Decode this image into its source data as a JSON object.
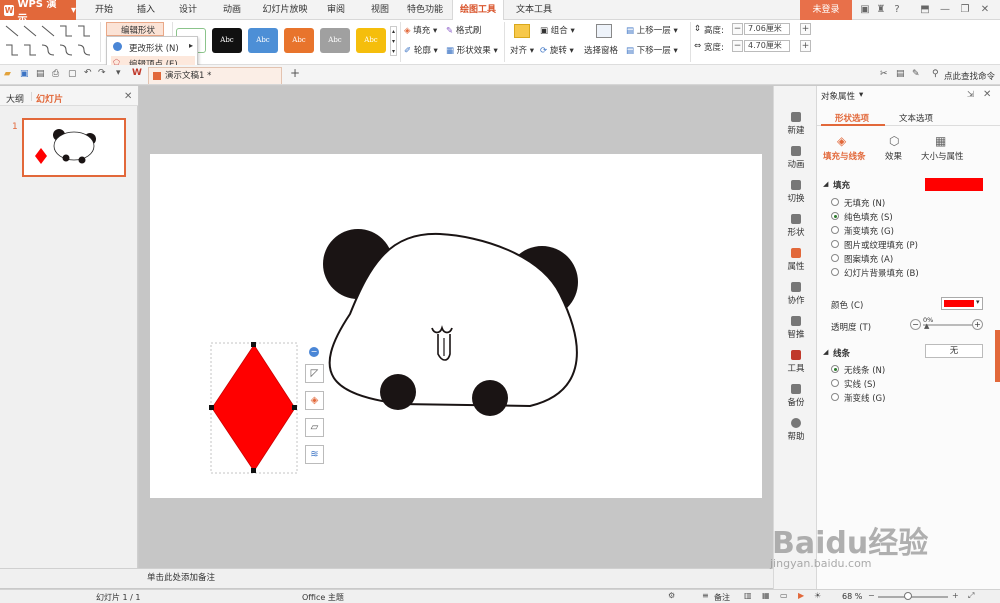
{
  "app": {
    "name": "WPS 演示"
  },
  "menu": {
    "tabs": [
      "开始",
      "插入",
      "设计",
      "动画",
      "幻灯片放映",
      "审阅",
      "视图",
      "特色功能",
      "绘图工具",
      "文本工具"
    ],
    "active": "绘图工具",
    "login": "未登录"
  },
  "ribbon": {
    "edit_shape": "编辑形状",
    "style_label": "Abc",
    "fill": "填充",
    "format_painter": "格式刷",
    "outline": "轮廓",
    "shape_effects": "形状效果",
    "align": "对齐",
    "group": "组合",
    "rotate": "旋转",
    "selection_pane": "选择窗格",
    "bring_forward": "上移一层",
    "send_backward": "下移一层",
    "height_label": "高度:",
    "height_value": "7.06厘米",
    "width_label": "宽度:",
    "width_value": "4.70厘米"
  },
  "dropdown": {
    "items": [
      "更改形状 (N)",
      "编辑顶点 (E)"
    ]
  },
  "quickbar": {
    "doc_tab": "演示文稿1 *",
    "search": "点此查找命令"
  },
  "leftpanel": {
    "tab_outline": "大纲",
    "tab_slides": "幻灯片",
    "slide_number": "1"
  },
  "sidebar": {
    "items": [
      "新建",
      "动画",
      "切换",
      "形状",
      "属性",
      "协作",
      "智推",
      "工具",
      "备份",
      "帮助"
    ]
  },
  "props": {
    "title": "对象属性",
    "tab_shape": "形状选项",
    "tab_text": "文本选项",
    "sub_fill": "填充与线条",
    "sub_effect": "效果",
    "sub_size": "大小与属性",
    "fill_section": "填充",
    "fill_options": [
      "无填充 (N)",
      "纯色填充 (S)",
      "渐变填充 (G)",
      "图片或纹理填充 (P)",
      "图案填充 (A)",
      "幻灯片背景填充 (B)"
    ],
    "color_label": "颜色 (C)",
    "transparency_label": "透明度 (T)",
    "transparency_value": "0%",
    "line_section": "线条",
    "line_value": "无",
    "line_options": [
      "无线条 (N)",
      "实线 (S)",
      "渐变线 (G)"
    ],
    "fill_color": "#ff0000"
  },
  "notes": {
    "placeholder": "单击此处添加备注"
  },
  "status": {
    "slide_info": "幻灯片 1 / 1",
    "theme": "Office 主题",
    "notes_btn": "备注",
    "zoom": "68 %"
  },
  "watermark": {
    "brand": "Baidu经验",
    "url": "jingyan.baidu.com"
  }
}
